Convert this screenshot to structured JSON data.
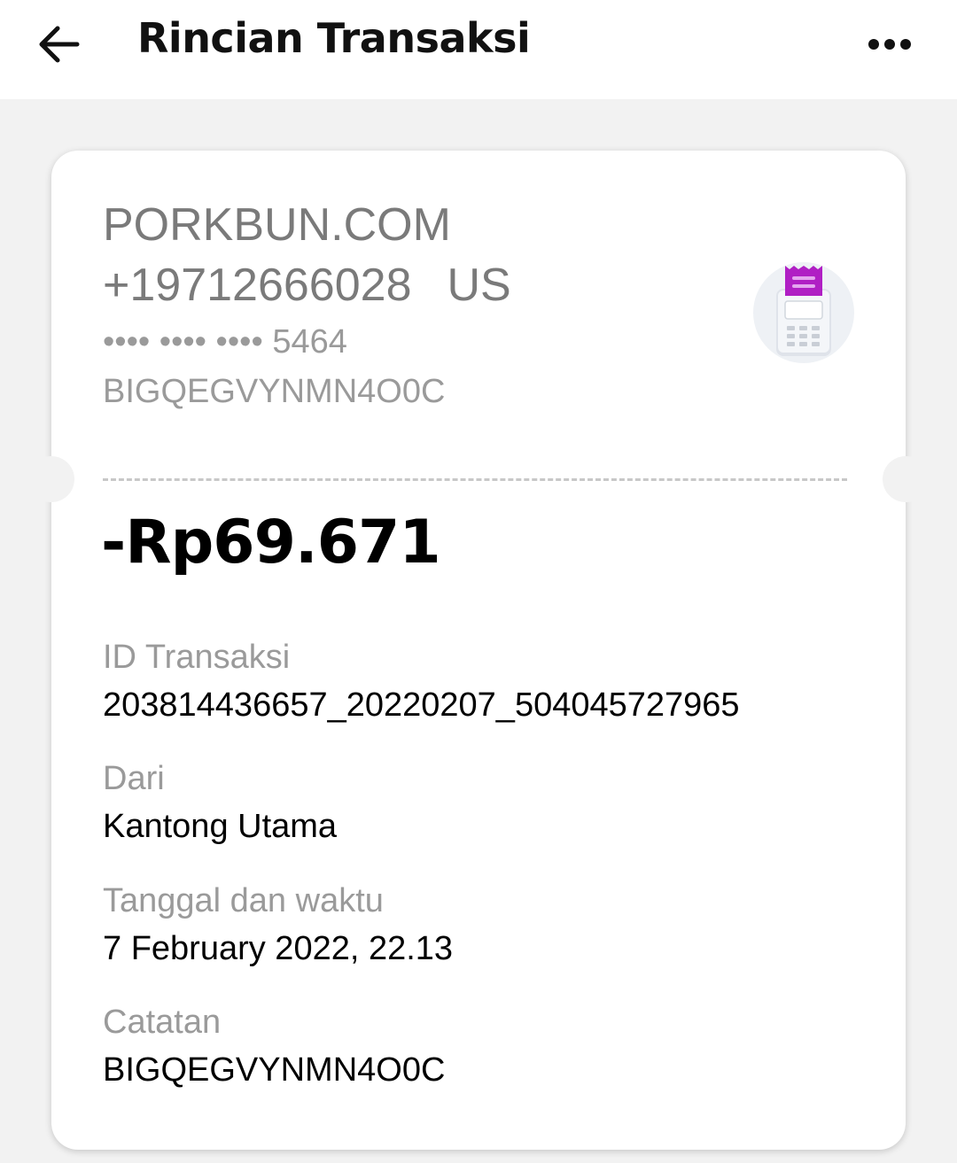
{
  "header": {
    "title": "Rincian Transaksi",
    "back_icon": "arrow-left-icon",
    "more_icon": "more-horizontal-icon"
  },
  "merchant": {
    "name": "PORKBUN.COM",
    "phone": "+19712666028",
    "country": "US",
    "card_masked": "•••• •••• •••• 5464",
    "reference": "BIGQEGVYNMN4O0C",
    "icon": "receipt-payment-terminal-icon"
  },
  "amount": "-Rp69.671",
  "details": [
    {
      "label": "ID Transaksi",
      "value": "203814436657_20220207_504045727965"
    },
    {
      "label": "Dari",
      "value": "Kantong Utama"
    },
    {
      "label": "Tanggal dan waktu",
      "value": "7 February 2022, 22.13"
    },
    {
      "label": "Catatan",
      "value": "BIGQEGVYNMN4O0C"
    }
  ],
  "colors": {
    "background": "#f2f2f2",
    "card": "#ffffff",
    "accent": "#b01fc4",
    "label_gray": "#9a9a9a"
  }
}
